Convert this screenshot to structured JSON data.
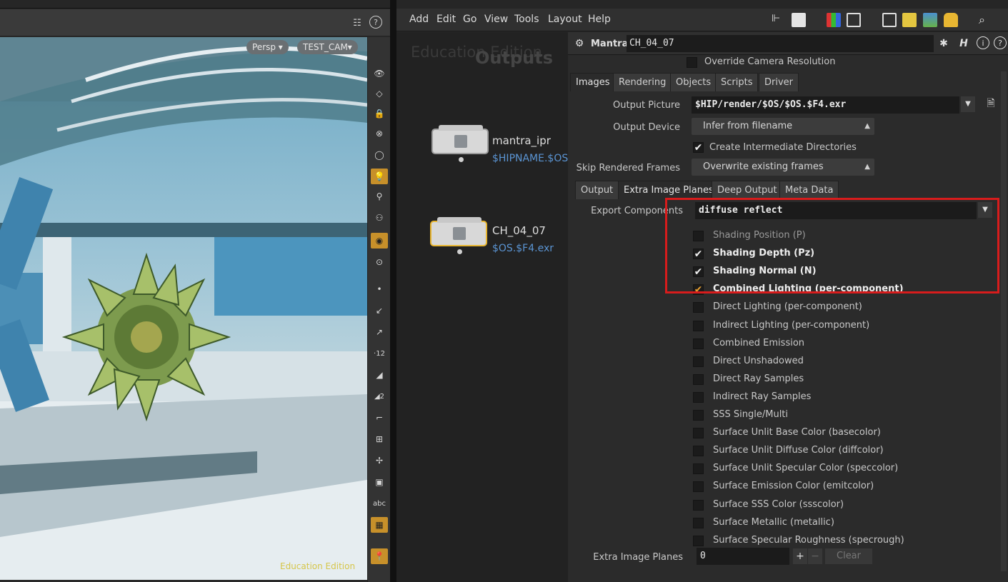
{
  "viewport": {
    "camera_mode": "Persp ▾",
    "camera_name": "TEST_CAM▾",
    "watermark": "Education Edition"
  },
  "menubar": {
    "items": [
      "Add",
      "Edit",
      "Go",
      "View",
      "Tools",
      "Layout",
      "Help"
    ]
  },
  "network": {
    "watermark": "Education Edition",
    "title": "Outputs",
    "nodes": [
      {
        "name": "mantra_ipr",
        "output": "$HIPNAME.$OS.$"
      },
      {
        "name": "CH_04_07",
        "output": "$OS.$F4.exr"
      }
    ]
  },
  "params": {
    "node_type": "Mantra",
    "node_name": "CH_04_07",
    "override_camera_resolution": "Override Camera Resolution",
    "tabs": [
      "Images",
      "Rendering",
      "Objects",
      "Scripts",
      "Driver"
    ],
    "output_picture_label": "Output Picture",
    "output_picture_value": "$HIP/render/$OS/$OS.$F4.exr",
    "output_device_label": "Output Device",
    "output_device_value": "Infer from filename",
    "create_dirs_label": "Create Intermediate Directories",
    "skip_frames_label": "Skip Rendered Frames",
    "skip_frames_value": "Overwrite existing frames",
    "subtabs": [
      "Output",
      "Extra Image Planes",
      "Deep Output",
      "Meta Data"
    ],
    "export_components_label": "Export Components",
    "export_components_value": "diffuse reflect",
    "planes": [
      {
        "label": "Shading Position (P)",
        "checked": false
      },
      {
        "label": "Shading Depth (Pz)",
        "checked": true
      },
      {
        "label": "Shading Normal (N)",
        "checked": true
      },
      {
        "label": "Combined Lighting (per-component)",
        "checked": true
      },
      {
        "label": "Direct Lighting (per-component)",
        "checked": false
      },
      {
        "label": "Indirect Lighting (per-component)",
        "checked": false
      },
      {
        "label": "Combined Emission",
        "checked": false
      },
      {
        "label": "Direct Unshadowed",
        "checked": false
      },
      {
        "label": "Direct Ray Samples",
        "checked": false
      },
      {
        "label": "Indirect Ray Samples",
        "checked": false
      },
      {
        "label": "SSS Single/Multi",
        "checked": false
      },
      {
        "label": "Surface Unlit Base Color (basecolor)",
        "checked": false
      },
      {
        "label": "Surface Unlit Diffuse Color (diffcolor)",
        "checked": false
      },
      {
        "label": "Surface Unlit Specular Color (speccolor)",
        "checked": false
      },
      {
        "label": "Surface Emission Color (emitcolor)",
        "checked": false
      },
      {
        "label": "Surface SSS Color (ssscolor)",
        "checked": false
      },
      {
        "label": "Surface Metallic (metallic)",
        "checked": false
      },
      {
        "label": "Surface Specular Roughness (specrough)",
        "checked": false
      }
    ],
    "extra_planes_label": "Extra Image Planes",
    "extra_planes_value": "0",
    "clear_label": "Clear"
  },
  "colors": {
    "highlight": "#d81c1c",
    "node_selected": "#e8b632",
    "link": "#5b95d4"
  }
}
